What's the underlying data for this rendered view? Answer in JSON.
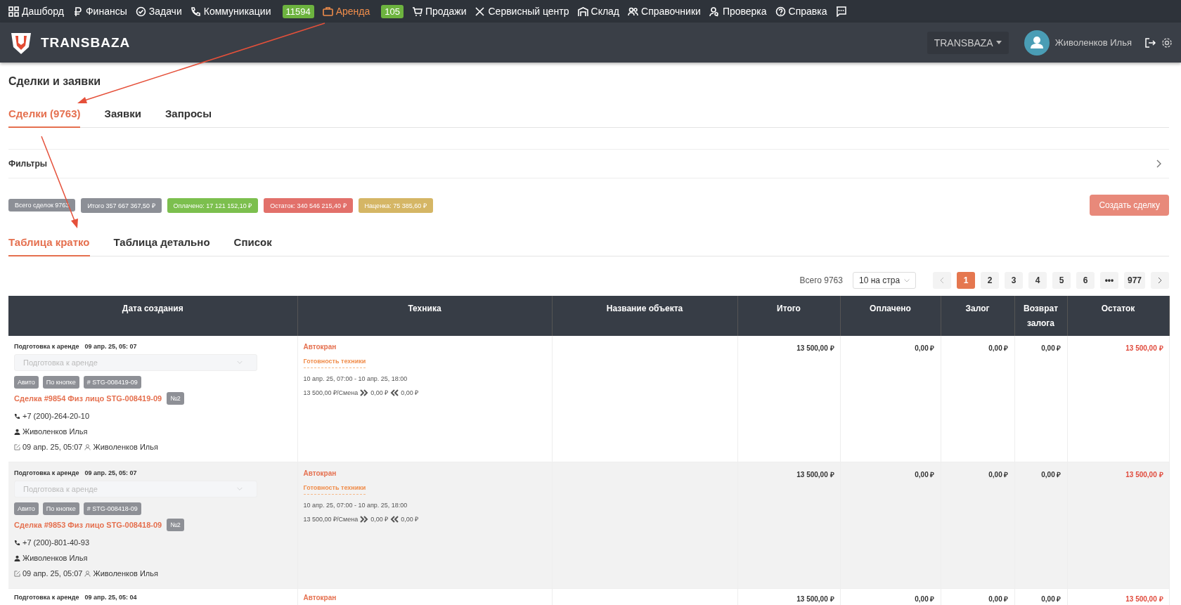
{
  "top_menu": [
    {
      "label": "Дашборд",
      "active": false
    },
    {
      "label": "Финансы",
      "active": false
    },
    {
      "label": "Задачи",
      "active": false
    },
    {
      "label": "Коммуникации",
      "active": false,
      "badge": "11594"
    },
    {
      "label": "Аренда",
      "active": true,
      "badge": "105"
    },
    {
      "label": "Продажи",
      "active": false
    },
    {
      "label": "Сервисный центр",
      "active": false
    },
    {
      "label": "Склад",
      "active": false
    },
    {
      "label": "Справочники",
      "active": false
    },
    {
      "label": "Проверка",
      "active": false
    },
    {
      "label": "Справка",
      "active": false
    }
  ],
  "header": {
    "logo": "TRANSBAZA",
    "company": "TRANSBAZA",
    "user": "Живоленков Илья"
  },
  "page_title": "Сделки и заявки",
  "tabs": [
    {
      "label": "Сделки (9763)",
      "selected": true
    },
    {
      "label": "Заявки",
      "selected": false
    },
    {
      "label": "Запросы",
      "selected": false
    }
  ],
  "filters": {
    "label": "Фильтры"
  },
  "stats": [
    {
      "label": "Всего сделок 9763",
      "color": "#8c8f96"
    },
    {
      "label": "Итого 357 667 367,50 ₽",
      "color": "#8c8f96"
    },
    {
      "label": "Оплачено: 17 121 152,10 ₽",
      "color": "#7cbf4e"
    },
    {
      "label": "Остаток: 340 546 215,40 ₽",
      "color": "#e2706a"
    },
    {
      "label": "Наценка: 75 385,60 ₽",
      "color": "#d5b665"
    }
  ],
  "create_button": "Создать сделку",
  "view_tabs": [
    {
      "label": "Таблица кратко",
      "selected": true
    },
    {
      "label": "Таблица детально",
      "selected": false
    },
    {
      "label": "Список",
      "selected": false
    }
  ],
  "pagination": {
    "total": "Всего 9763",
    "page_size": "10 на стра",
    "pages": [
      {
        "label": "1",
        "selected": true
      },
      {
        "label": "2",
        "selected": false
      },
      {
        "label": "3",
        "selected": false
      },
      {
        "label": "4",
        "selected": false
      },
      {
        "label": "5",
        "selected": false
      },
      {
        "label": "6",
        "selected": false
      },
      {
        "label": "•••",
        "selected": false
      },
      {
        "label": "977",
        "selected": false
      }
    ]
  },
  "table": {
    "columns": [
      "Дата создания",
      "Техника",
      "Название объекта",
      "Итого",
      "Оплачено",
      "Залог",
      "Возврат залога",
      "Остаток"
    ],
    "rows": [
      {
        "hovered": false,
        "status": "Подготовка к аренде",
        "date": "09 апр. 25, 05: 07",
        "status_select": "Подготовка к аренде",
        "tags": [
          "Авито",
          "По кнопке",
          "# STG-008419-09"
        ],
        "deal": "Сделка #9854 Физ лицо STG-008419-09",
        "number": "№2",
        "phone": "+7 (200)-264-20-10",
        "manager": "Живоленков Илья",
        "created": "09 апр. 25, 05:07",
        "author": "Живоленков Илья",
        "equipment": "Автокран",
        "readiness": "Готовность техники",
        "period": "10 апр. 25, 07:00 - 10 апр. 25, 18:00",
        "rate": "13 500,00 ₽/Смена",
        "delivery": "0,00 ₽",
        "return": "0,00 ₽",
        "total": "13 500,00 ₽",
        "paid": "0,00 ₽",
        "deposit": "0,00 ₽",
        "deposit_return": "0,00 ₽",
        "balance": "13 500,00 ₽"
      },
      {
        "hovered": true,
        "status": "Подготовка к аренде",
        "date": "09 апр. 25, 05: 07",
        "status_select": "Подготовка к аренде",
        "tags": [
          "Авито",
          "По кнопке",
          "# STG-008418-09"
        ],
        "deal": "Сделка #9853 Физ лицо STG-008418-09",
        "number": "№2",
        "phone": "+7 (200)-801-40-93",
        "manager": "Живоленков Илья",
        "created": "09 апр. 25, 05:07",
        "author": "Живоленков Илья",
        "equipment": "Автокран",
        "readiness": "Готовность техники",
        "period": "10 апр. 25, 07:00 - 10 апр. 25, 18:00",
        "rate": "13 500,00 ₽/Смена",
        "delivery": "0,00 ₽",
        "return": "0,00 ₽",
        "total": "13 500,00 ₽",
        "paid": "0,00 ₽",
        "deposit": "0,00 ₽",
        "deposit_return": "0,00 ₽",
        "balance": "13 500,00 ₽"
      },
      {
        "hovered": false,
        "status": "Подготовка к аренде",
        "date": "09 апр. 25, 05: 04",
        "equipment": "Автокран",
        "total": "13 500,00 ₽",
        "paid": "0,00 ₽",
        "deposit": "0,00 ₽",
        "deposit_return": "0,00 ₽",
        "balance": "13 500,00 ₽"
      }
    ]
  }
}
